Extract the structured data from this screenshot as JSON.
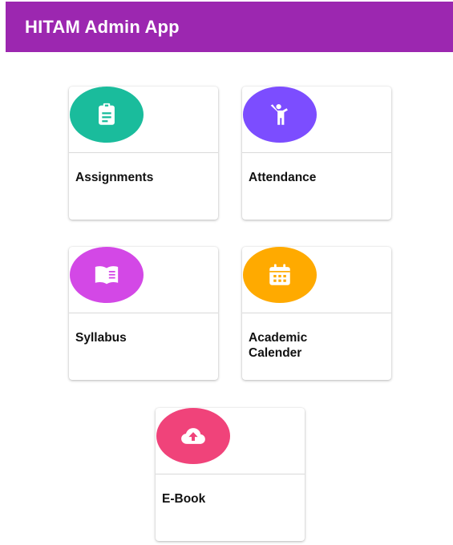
{
  "app_bar": {
    "title": "HITAM Admin App",
    "color": "#9c27b0"
  },
  "cards": [
    {
      "label": "Assignments",
      "icon": "clipboard-icon",
      "color": "#1abc9c"
    },
    {
      "label": "Attendance",
      "icon": "person-raising-hand-icon",
      "color": "#7c4dff"
    },
    {
      "label": "Syllabus",
      "icon": "book-icon",
      "color": "#d348e6"
    },
    {
      "label": "Academic\nCalender",
      "icon": "calendar-icon",
      "color": "#ffaa00"
    },
    {
      "label": "E-Book",
      "icon": "cloud-upload-icon",
      "color": "#f0437a"
    }
  ]
}
